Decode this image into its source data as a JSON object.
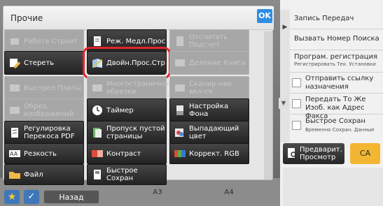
{
  "dialog": {
    "title": "Прочие",
    "ok_label": "OK"
  },
  "functions": {
    "work_build": "Работа Строит",
    "special_modes": "Реж. Медл.Прос",
    "original_count": "Отсчитать Подсчет",
    "erase": "Стереть",
    "dual_page_scan": "Двойн.Прос.Стр",
    "book_divide": "Деление Книги",
    "card_shot": "Выстрел Платы",
    "multi_crop": "Многостраничная обрезка",
    "scan_to_edge": "Сканир-ние вкл-ся",
    "image_edit": "Обрез. изображений",
    "timer": "Таймер",
    "bg_adjust": "Настройка Фона",
    "skew_adjust": "Регулировка Перекоса PDF",
    "blank_skip": "Пропуск пустой страницы",
    "color_dropout": "Выпадающий цвет",
    "sharpness": "Резкость",
    "contrast": "Контраст",
    "rgb_adjust": "Коррект. RGB",
    "file": "Файл",
    "quick_save": "Быстрое Сохран"
  },
  "right_panel": {
    "record_transmission": "Запись Передач",
    "call_search_number": "Вызвать Номер Поиска",
    "program_registration": "Програм. регистрация",
    "program_registration_sub": "Регистрировать Тек. Установки",
    "send_dest_link": "Отправить ссылку назначения",
    "send_same_image_fax": "Передать То Же Изоб. как Адрес Факса",
    "quick_save": "Быстрое Сохран",
    "quick_save_sub": "Временно Сохран. Данные"
  },
  "buttons": {
    "preview": "Предварит. Просмотр",
    "ca": "CA",
    "back": "Назад"
  },
  "bottom_tabs": {
    "a3": "A3",
    "a4": "A4"
  },
  "colors": {
    "ok_blue": "#2f8de4",
    "highlight_red": "#e2242b",
    "ca_yellow": "#f2b632"
  }
}
